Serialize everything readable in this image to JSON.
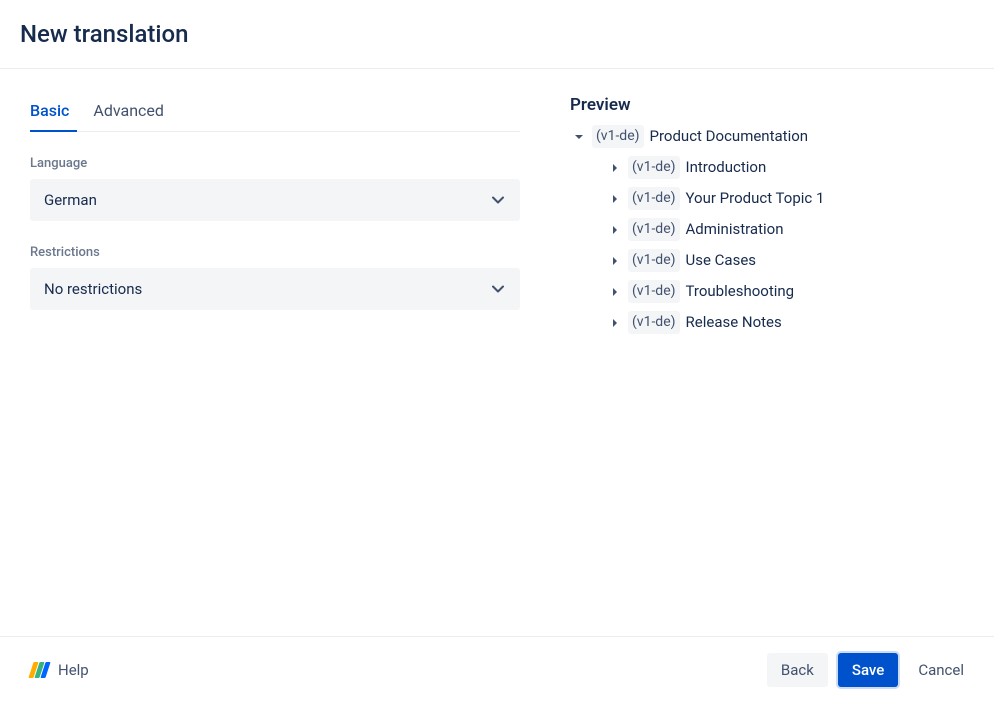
{
  "header": {
    "title": "New translation"
  },
  "tabs": {
    "basic": "Basic",
    "advanced": "Advanced",
    "active": "basic"
  },
  "form": {
    "language": {
      "label": "Language",
      "value": "German"
    },
    "restrictions": {
      "label": "Restrictions",
      "value": "No restrictions"
    }
  },
  "preview": {
    "title": "Preview",
    "root": {
      "tag": "(v1-de)",
      "label": "Product Documentation"
    },
    "children": [
      {
        "tag": "(v1-de)",
        "label": "Introduction"
      },
      {
        "tag": "(v1-de)",
        "label": "Your Product Topic 1"
      },
      {
        "tag": "(v1-de)",
        "label": "Administration"
      },
      {
        "tag": "(v1-de)",
        "label": "Use Cases"
      },
      {
        "tag": "(v1-de)",
        "label": "Troubleshooting"
      },
      {
        "tag": "(v1-de)",
        "label": "Release Notes"
      }
    ]
  },
  "footer": {
    "help": "Help",
    "back": "Back",
    "save": "Save",
    "cancel": "Cancel"
  }
}
